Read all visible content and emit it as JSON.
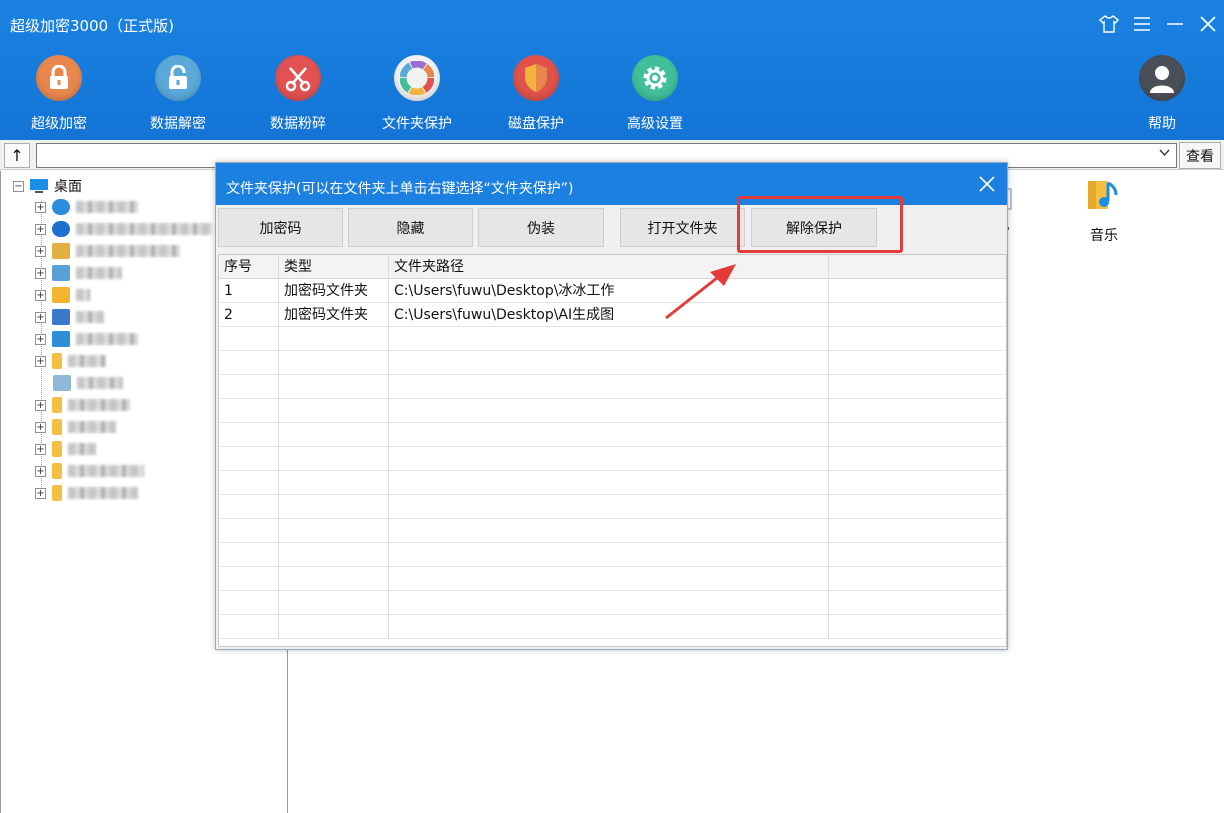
{
  "app": {
    "title": "超级加密3000（正式版)"
  },
  "toolbar": {
    "items": [
      {
        "label": "超级加密",
        "icon": "padlock-icon",
        "color": "#e8874d"
      },
      {
        "label": "数据解密",
        "icon": "unlock-icon",
        "color": "#5aa9d8"
      },
      {
        "label": "数据粉碎",
        "icon": "scissors-icon",
        "color": "#e25252"
      },
      {
        "label": "文件夹保护",
        "icon": "color-wheel-icon",
        "color": "#f2f2f2"
      },
      {
        "label": "磁盘保护",
        "icon": "shield-icon",
        "color": "#e0524a"
      },
      {
        "label": "高级设置",
        "icon": "gear-icon",
        "color": "#3fbf9a"
      }
    ],
    "help_label": "帮助"
  },
  "addressbar": {
    "up_label": "↑",
    "view_label": "查看",
    "value": ""
  },
  "tree": {
    "root_label": "桌面"
  },
  "files": {
    "music_label": "音乐"
  },
  "dialog": {
    "title": "文件夹保护(可以在文件夹上单击右键选择“文件夹保护”)",
    "buttons": {
      "password": "加密码",
      "hide": "隐藏",
      "disguise": "伪装",
      "open_folder": "打开文件夹",
      "unprotect": "解除保护"
    },
    "table": {
      "columns": [
        "序号",
        "类型",
        "文件夹路径",
        ""
      ],
      "rows": [
        [
          "1",
          "加密码文件夹",
          "C:\\Users\\fuwu\\Desktop\\冰冰工作",
          ""
        ],
        [
          "2",
          "加密码文件夹",
          "C:\\Users\\fuwu\\Desktop\\AI生成图",
          ""
        ]
      ]
    }
  },
  "colors": {
    "titlebar": "#1b7ee0",
    "highlight": "#e53a3a"
  }
}
